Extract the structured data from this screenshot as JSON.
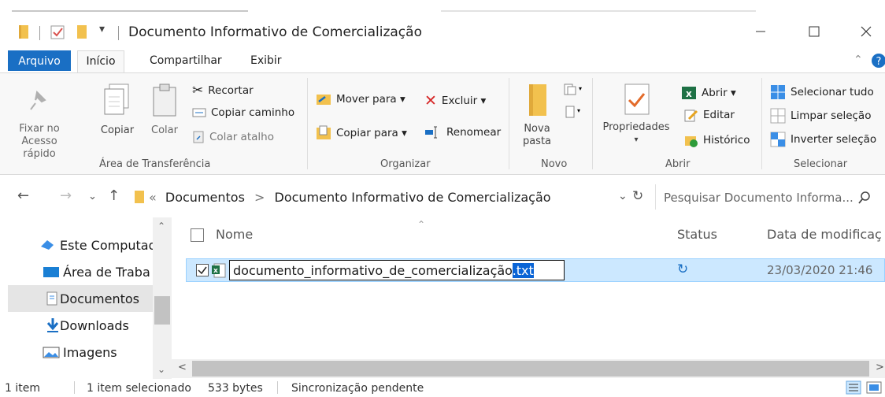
{
  "window": {
    "title": "Documento Informativo de Comercialização"
  },
  "tabs": {
    "file": "Arquivo",
    "home": "Início",
    "share": "Compartilhar",
    "view": "Exibir"
  },
  "ribbon": {
    "clipboard": {
      "pin": "Fixar no",
      "pin2": "Acesso rápido",
      "copy": "Copiar",
      "paste": "Colar",
      "cut": "Recortar",
      "copy_path": "Copiar caminho",
      "paste_shortcut": "Colar atalho",
      "label": "Área de Transferência"
    },
    "organize": {
      "move_to": "Mover para ▾",
      "delete": "Excluir ▾",
      "copy_to": "Copiar para ▾",
      "rename": "Renomear",
      "label": "Organizar"
    },
    "new": {
      "new_folder": "Nova",
      "new_folder2": "pasta",
      "label": "Novo"
    },
    "open": {
      "properties": "Propriedades",
      "open": "Abrir ▾",
      "edit": "Editar",
      "history": "Histórico",
      "label": "Abrir"
    },
    "select": {
      "select_all": "Selecionar tudo",
      "select_none": "Limpar seleção",
      "invert": "Inverter seleção",
      "label": "Selecionar"
    }
  },
  "address": {
    "chevrons": "«",
    "crumb1": "Documentos",
    "sep": ">",
    "crumb2": "Documento Informativo de Comercialização",
    "search_placeholder": "Pesquisar Documento Informa..."
  },
  "nav_pane": {
    "items": [
      {
        "label": "Este Computad"
      },
      {
        "label": "Área de Traba"
      },
      {
        "label": "Documentos"
      },
      {
        "label": "Downloads"
      },
      {
        "label": "Imagens"
      }
    ]
  },
  "columns": {
    "name": "Nome",
    "status": "Status",
    "date": "Data de modificaç"
  },
  "files": [
    {
      "name": "documento_informativo_de_comercialização",
      "ext": ".txt",
      "date": "23/03/2020 21:46"
    }
  ],
  "statusbar": {
    "count": "1 item",
    "selected": "1 item selecionado",
    "size": "533 bytes",
    "sync": "Sincronização pendente"
  },
  "colors": {
    "accent": "#1a6fc4",
    "selection": "#cce8ff",
    "folder": "#f2c14e"
  }
}
